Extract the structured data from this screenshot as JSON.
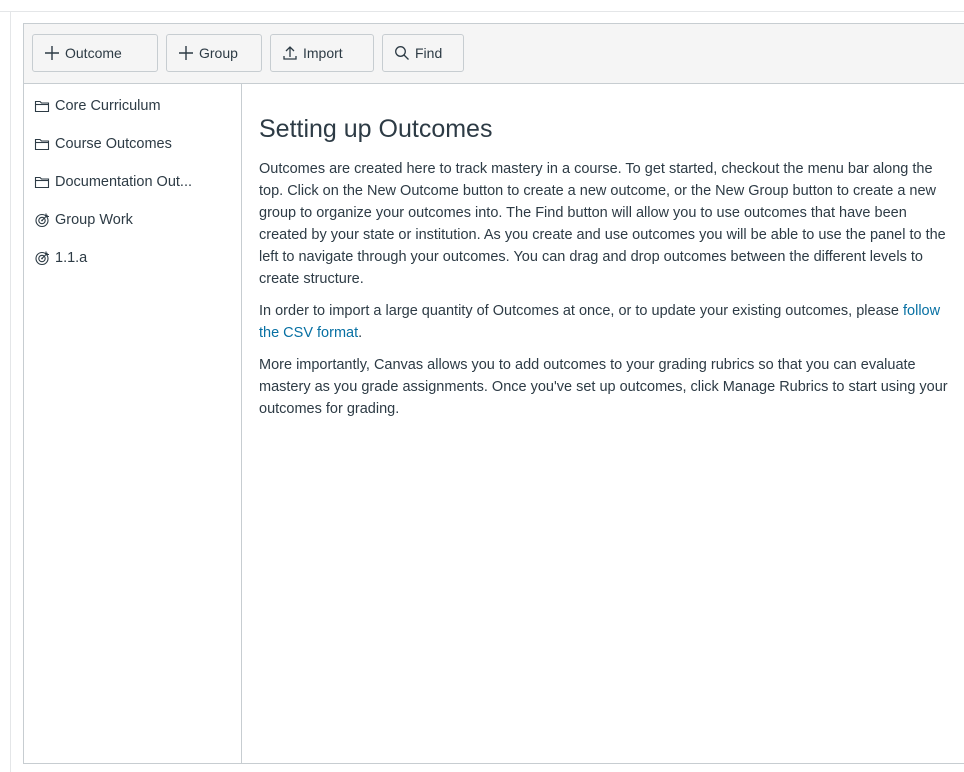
{
  "toolbar": {
    "outcome_label": "Outcome",
    "group_label": "Group",
    "import_label": "Import",
    "find_label": "Find"
  },
  "tree": {
    "items": [
      {
        "label": "Core Curriculum",
        "icon": "folder-icon"
      },
      {
        "label": "Course Outcomes",
        "icon": "folder-icon"
      },
      {
        "label": "Documentation Out...",
        "icon": "folder-icon"
      },
      {
        "label": "Group Work",
        "icon": "outcome-target-icon"
      },
      {
        "label": "1.1.a",
        "icon": "outcome-target-icon"
      }
    ]
  },
  "content": {
    "title": "Setting up Outcomes",
    "paragraph1": "Outcomes are created here to track mastery in a course. To get started, checkout the menu bar along the top. Click on the New Outcome button to create a new outcome, or the New Group button to create a new group to organize your outcomes into. The Find button will allow you to use outcomes that have been created by your state or institution. As you create and use outcomes you will be able to use the panel to the left to navigate through your outcomes. You can drag and drop outcomes between the different levels to create structure.",
    "paragraph2_before": "In order to import a large quantity of Outcomes at once, or to update your existing outcomes, please ",
    "paragraph2_link": "follow the CSV format",
    "paragraph2_after": ".",
    "paragraph3": "More importantly, Canvas allows you to add outcomes to your grading rubrics so that you can evaluate mastery as you grade assignments. Once you've set up outcomes, click Manage Rubrics to start using your outcomes for grading."
  },
  "colors": {
    "text": "#2d3b45",
    "link": "#0770a3",
    "border": "#c7cdd1",
    "toolbar_bg": "#f5f5f5"
  }
}
